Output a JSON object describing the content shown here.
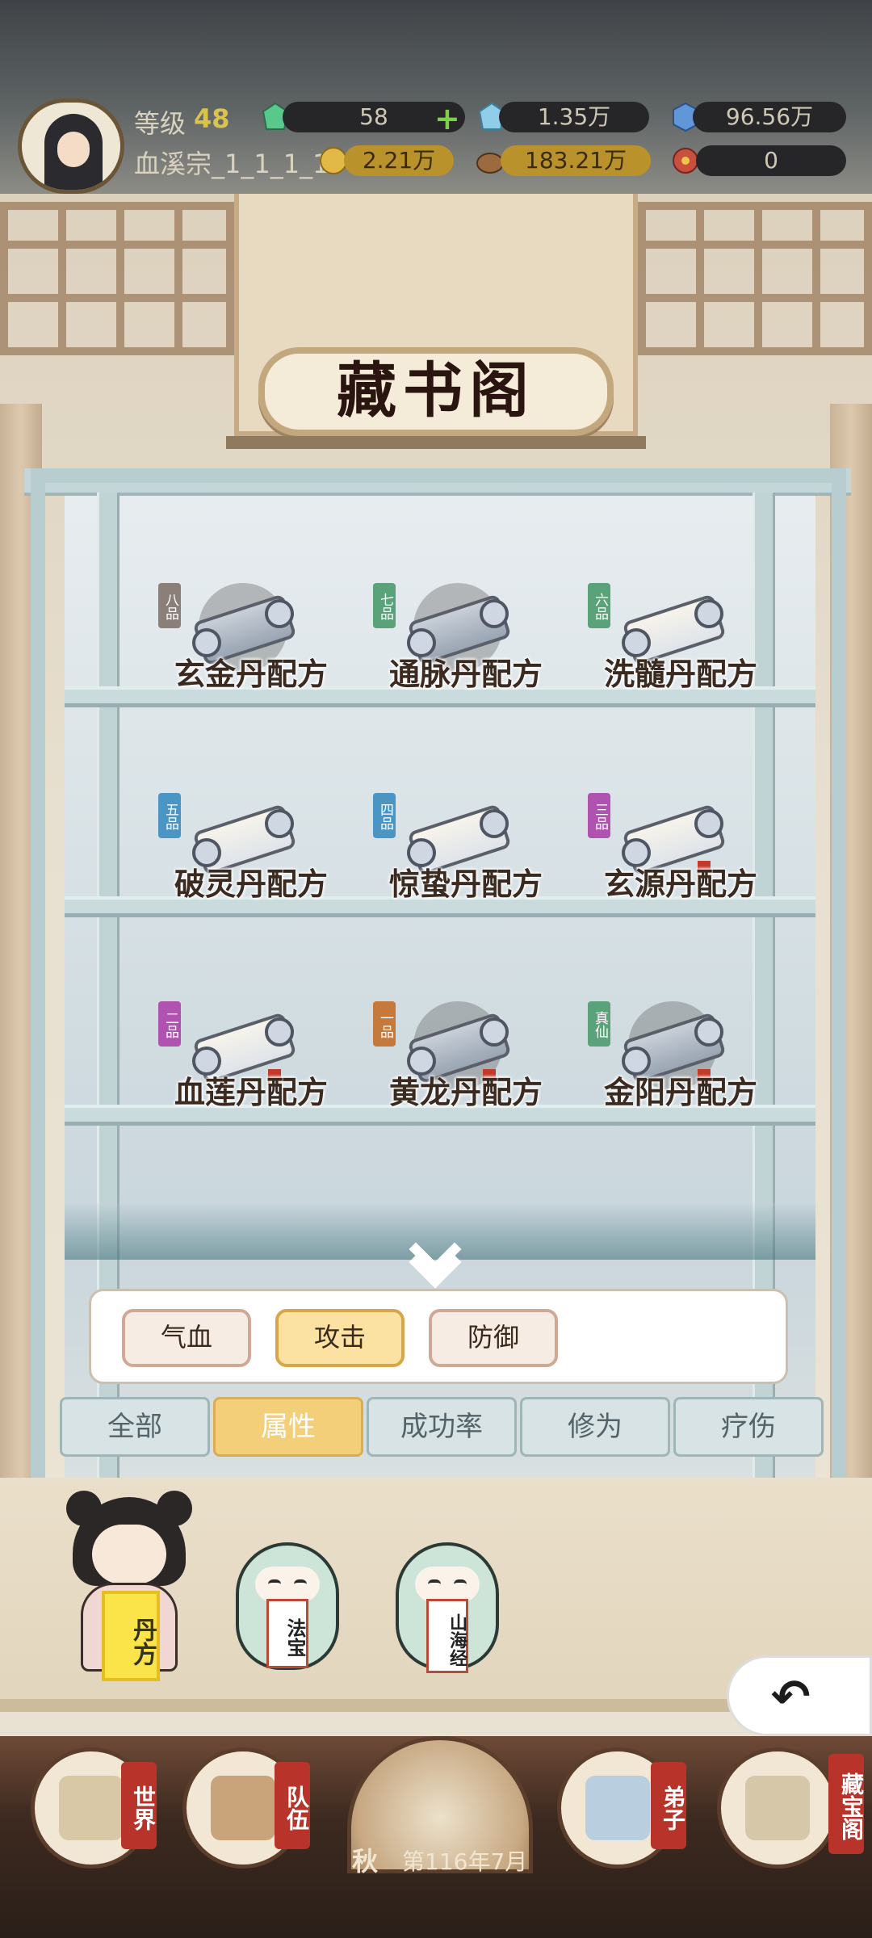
{
  "header": {
    "level_label": "等级",
    "level_value": "48",
    "sect_name": "血溪宗_1_1_1_1",
    "resources": [
      {
        "icon": "spirit-stone-green-icon",
        "value": "58",
        "color": "#4fbf77"
      },
      {
        "icon": "spirit-stone-rainbow-icon",
        "value": "1.35万",
        "color": "#7bc3e0"
      },
      {
        "icon": "blue-crystal-icon",
        "value": "96.56万",
        "color": "#4c8ad6"
      },
      {
        "icon": "gold-coin-icon",
        "value": "2.21万",
        "color": "#d3a733"
      },
      {
        "icon": "food-icon",
        "value": "183.21万",
        "color": "#8a5a32"
      },
      {
        "icon": "red-flower-icon",
        "value": "0",
        "color": "#c84536"
      }
    ]
  },
  "building": {
    "title": "藏书阁"
  },
  "shelf": {
    "items": [
      {
        "name": "玄金丹配方",
        "grade": "八品",
        "grade_color": "#8b7f7a",
        "dim": true
      },
      {
        "name": "通脉丹配方",
        "grade": "七品",
        "grade_color": "#5aa37a",
        "dim": true
      },
      {
        "name": "洗髓丹配方",
        "grade": "六品",
        "grade_color": "#5aa37a",
        "dim": false
      },
      {
        "name": "破灵丹配方",
        "grade": "五品",
        "grade_color": "#4a95c4",
        "dim": false
      },
      {
        "name": "惊蛰丹配方",
        "grade": "四品",
        "grade_color": "#4a95c4",
        "dim": false
      },
      {
        "name": "玄源丹配方",
        "grade": "三品",
        "grade_color": "#b052b0",
        "dim": false
      },
      {
        "name": "血莲丹配方",
        "grade": "二品",
        "grade_color": "#b052b0",
        "dim": false
      },
      {
        "name": "黄龙丹配方",
        "grade": "一品",
        "grade_color": "#c57a3c",
        "dim": true
      },
      {
        "name": "金阳丹配方",
        "grade": "真仙",
        "grade_color": "#5aa37a",
        "dim": true
      }
    ]
  },
  "filters": {
    "sub_options": [
      {
        "label": "气血",
        "active": false
      },
      {
        "label": "攻击",
        "active": true
      },
      {
        "label": "防御",
        "active": false
      }
    ],
    "tabs": [
      {
        "label": "全部",
        "active": false
      },
      {
        "label": "属性",
        "active": true
      },
      {
        "label": "成功率",
        "active": false
      },
      {
        "label": "修为",
        "active": false
      },
      {
        "label": "疗伤",
        "active": false
      }
    ]
  },
  "categories": [
    {
      "label": "丹方",
      "active": true
    },
    {
      "label": "法宝",
      "active": false
    },
    {
      "label": "山海经",
      "active": false
    }
  ],
  "bottom_nav": {
    "items": [
      {
        "label": "世界",
        "icon": "world-map-icon"
      },
      {
        "label": "队伍",
        "icon": "team-flag-icon"
      },
      {
        "label": "弟子",
        "icon": "disciple-icon"
      },
      {
        "label": "藏宝阁",
        "icon": "treasure-pavilion-icon"
      }
    ],
    "season": "秋",
    "date": "第116年7月"
  }
}
